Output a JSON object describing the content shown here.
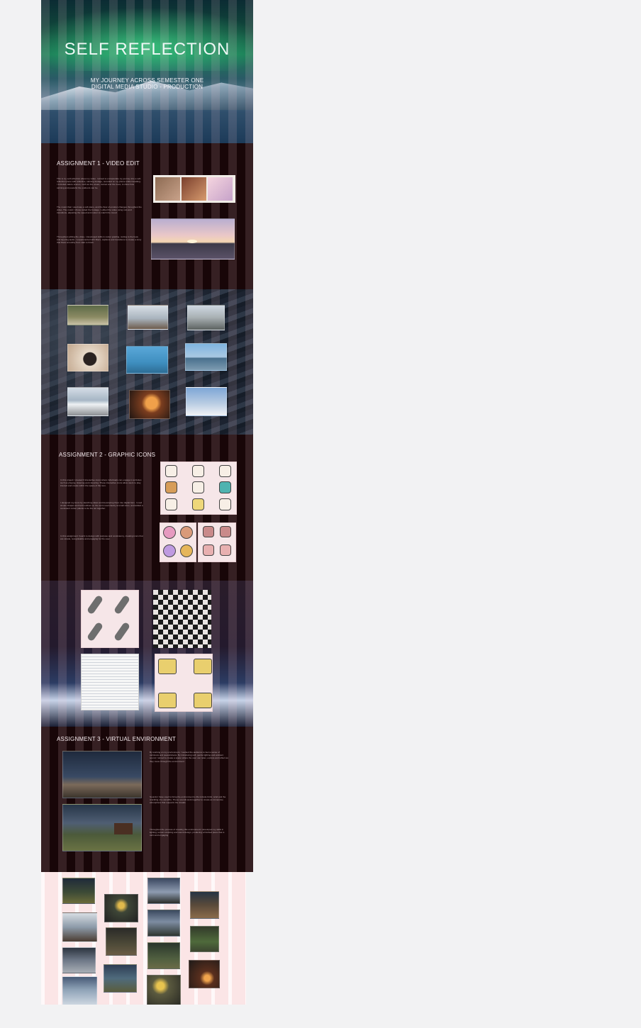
{
  "hero": {
    "title": "SELF REFLECTION",
    "subtitle_line1": "MY JOURNEY ACROSS SEMESTER ONE",
    "subtitle_line2": "DIGITAL MEDIA STUDIO - PRODUCTION"
  },
  "assignment1": {
    "heading": "ASSIGNMENT 1 - VIDEO EDIT",
    "paragraphs": [
      "This is my self-reflection about my video. I aimed to encapsulate my journey into a self-reflection piece with reflective, calming footage, recorded on my phone while travelling. I included nature scenes, such as the ocean, sunset and the trees, to show how calming and peaceful the outdoors can be.",
      "The music that I used was a soft piano, and the flow of emotion changes throughout the video. The music I chose suited the footage. I edited the video using cuts and transitions, adjusting the speed and colour to match the mood.",
      "Throughout editing the video, I developed skills in colour grading, cutting to the beat, and layering audio. I experimented with filters, captions and transitions to create a story that flows smoothly from start to finish."
    ]
  },
  "assignment2": {
    "heading": "ASSIGNMENT 2 - GRAPHIC ICONS",
    "paragraphs": [
      "In this project I created 3 interactive icons where individuals can engage in activities such as playing, listening and colouring. These interactive icons allow users to play, interact and create within the space of the icon.",
      "I designed my icons by sketching ideas and developing them into digital form. I used simple shapes and bold outlines so the icons read clearly at small sizes, and added a consistent colour palette to tie the set together.",
      "In this assignment I learnt to design with purpose and consistency, creating icons that are simple, recognisable and engaging for the user."
    ]
  },
  "assignment3": {
    "heading": "ASSIGNMENT 3 - VIRTUAL ENVIRONMENT",
    "paragraphs": [
      "By working on my environment, I wanted the audience to feel a sense of calmness and peacefulness. By introducing soft, gentle lighting and ambient sound, I aimed to create a space where the user can relax, explore and reflect as they move through the environment.",
      "Sounds I have used to bring the environment to life include birds, wind and the crackling of a campfire. These sounds work together to create an immersive atmosphere that supports the visuals.",
      "Throughout the process of creating this environment I developed my skills in lighting, terrain sculpting and sound design, producing a finished piece that is calm and engaging."
    ]
  },
  "colors": {
    "dark_bg": "#180608",
    "pink_bg": "#fbe5e6",
    "page_bg": "#f2f2f3"
  }
}
